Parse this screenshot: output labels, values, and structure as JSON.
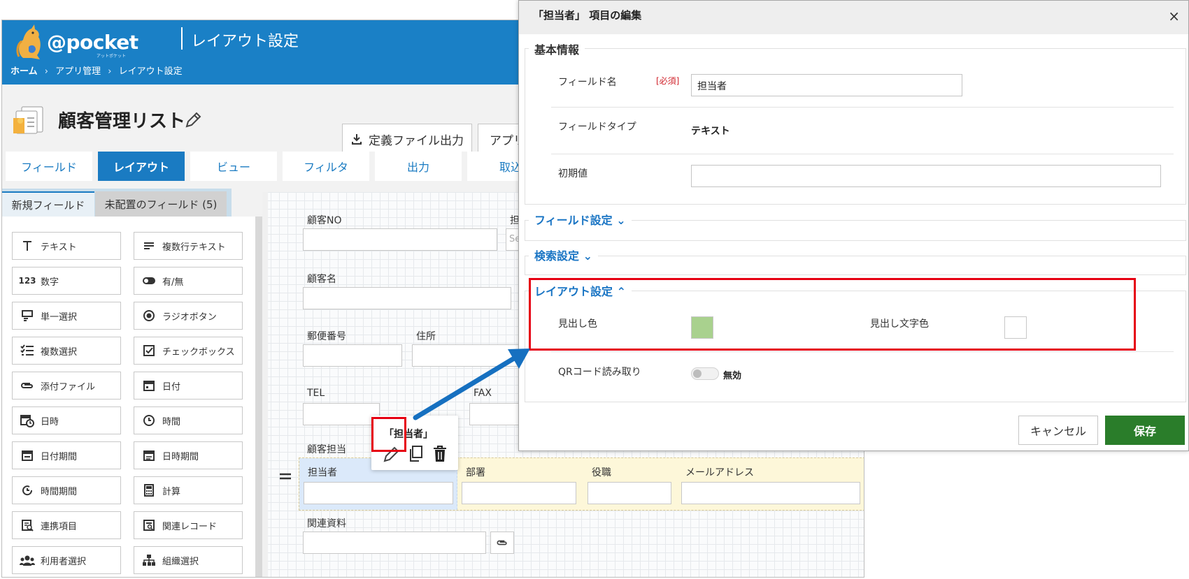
{
  "app": {
    "logo_text": "@pocket",
    "logo_sub": "アットポケット",
    "header_title": "レイアウト設定",
    "breadcrumbs": [
      "ホーム",
      "アプリ管理",
      "レイアウト設定"
    ],
    "breadcrumb_sep": "›",
    "app_name": "顧客管理リスト",
    "btn_export": "定義ファイル出力",
    "btn_app": "アプリ",
    "tabs": [
      "フィールド",
      "レイアウト",
      "ビュー",
      "フィルタ",
      "出力",
      "取込"
    ],
    "active_tab": "レイアウト",
    "subtabs": {
      "new": "新規フィールド",
      "unplaced": "未配置のフィールド (5)"
    },
    "palette": [
      {
        "label": "テキスト",
        "icon": "text-icon"
      },
      {
        "label": "複数行テキスト",
        "icon": "multiline-icon"
      },
      {
        "label": "数字",
        "icon": "number-icon"
      },
      {
        "label": "有/無",
        "icon": "toggle-icon"
      },
      {
        "label": "単一選択",
        "icon": "single-select-icon"
      },
      {
        "label": "ラジオボタン",
        "icon": "radio-icon"
      },
      {
        "label": "複数選択",
        "icon": "multi-select-icon"
      },
      {
        "label": "チェックボックス",
        "icon": "checkbox-icon"
      },
      {
        "label": "添付ファイル",
        "icon": "attachment-icon"
      },
      {
        "label": "日付",
        "icon": "calendar-icon"
      },
      {
        "label": "日時",
        "icon": "datetime-icon"
      },
      {
        "label": "時間",
        "icon": "clock-icon"
      },
      {
        "label": "日付期間",
        "icon": "date-range-icon"
      },
      {
        "label": "日時期間",
        "icon": "datetime-range-icon"
      },
      {
        "label": "時間期間",
        "icon": "time-range-icon"
      },
      {
        "label": "計算",
        "icon": "calculator-icon"
      },
      {
        "label": "連携項目",
        "icon": "linked-item-icon"
      },
      {
        "label": "関連レコード",
        "icon": "related-record-icon"
      },
      {
        "label": "利用者選択",
        "icon": "users-icon"
      },
      {
        "label": "組織選択",
        "icon": "org-chart-icon"
      }
    ],
    "canvas": {
      "customer_no": "顧客NO",
      "assignee_partial": "担",
      "select_partial": "Se",
      "customer_name": "顧客名",
      "postal_code": "郵便番号",
      "address": "住所",
      "tel": "TEL",
      "fax": "FAX",
      "customer_owner": "顧客担当",
      "group_fields": [
        "担当者",
        "部署",
        "役職",
        "メールアドレス"
      ],
      "related_docs": "関連資料"
    },
    "popover": {
      "title": "「担当者」"
    }
  },
  "modal": {
    "title": "「担当者」 項目の編集",
    "close": "×",
    "basic_section": "基本情報",
    "field_name_label": "フィールド名",
    "required_badge": "[必須]",
    "field_name_value": "担当者",
    "field_type_label": "フィールドタイプ",
    "field_type_value": "テキスト",
    "default_label": "初期値",
    "default_value": "",
    "field_settings": "フィールド設定",
    "search_settings": "検索設定",
    "layout_settings": "レイアウト設定",
    "heading_color_label": "見出し色",
    "heading_color": "#a9d18e",
    "heading_text_color_label": "見出し文字色",
    "heading_text_color": "#ffffff",
    "qr_label": "QRコード読み取り",
    "qr_state": "無効",
    "cancel": "キャンセル",
    "save": "保存"
  },
  "colors": {
    "brand_blue": "#1a80c6",
    "save_green": "#2a7d2a",
    "highlight_red": "#e60012"
  }
}
